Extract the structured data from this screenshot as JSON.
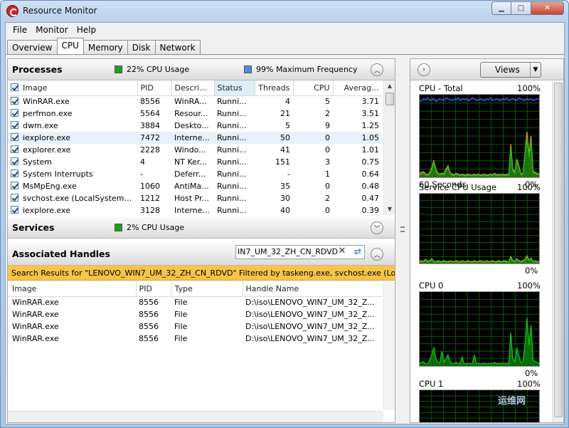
{
  "window": {
    "title": "Resource Monitor"
  },
  "menu": [
    "File",
    "Monitor",
    "Help"
  ],
  "tabs": [
    "Overview",
    "CPU",
    "Memory",
    "Disk",
    "Network"
  ],
  "active_tab": "CPU",
  "processes": {
    "title": "Processes",
    "cpu_usage": "22% CPU Usage",
    "max_frequency": "99% Maximum Frequency",
    "columns": [
      "Image",
      "PID",
      "Descrip...",
      "Status",
      "Threads",
      "CPU",
      "Averag..."
    ],
    "rows": [
      [
        "WinRAR.exe",
        "8556",
        "WinRA...",
        "Runni...",
        "4",
        "5",
        "3.71"
      ],
      [
        "perfmon.exe",
        "5564",
        "Resour...",
        "Runni...",
        "21",
        "2",
        "3.51"
      ],
      [
        "dwm.exe",
        "3884",
        "Deskto...",
        "Runni...",
        "5",
        "9",
        "1.25"
      ],
      [
        "iexplore.exe",
        "7472",
        "Interne...",
        "Runni...",
        "50",
        "0",
        "1.05"
      ],
      [
        "explorer.exe",
        "2228",
        "Windo...",
        "Runni...",
        "41",
        "0",
        "1.01"
      ],
      [
        "System",
        "4",
        "NT Ker...",
        "Runni...",
        "151",
        "3",
        "0.75"
      ],
      [
        "System Interrupts",
        "-",
        "Deferr...",
        "Runni...",
        "-",
        "1",
        "0.64"
      ],
      [
        "MsMpEng.exe",
        "1060",
        "AntiMa...",
        "Runni...",
        "35",
        "0",
        "0.48"
      ],
      [
        "svchost.exe (LocalSystemNet...",
        "1212",
        "Host Pr...",
        "Runni...",
        "30",
        "2",
        "0.47"
      ],
      [
        "iexplore.exe",
        "3128",
        "Interne...",
        "Runni...",
        "40",
        "0",
        "0.39"
      ]
    ]
  },
  "services": {
    "title": "Services",
    "cpu_usage": "2% CPU Usage"
  },
  "handles": {
    "title": "Associated Handles",
    "search_value": "IN7_UM_32_ZH_CN_RDVD",
    "banner": "Search Results for \"LENOVO_WIN7_UM_32_ZH_CN_RDVD\" Filtered by taskeng.exe, svchost.exe (Loc...",
    "columns": [
      "Image",
      "PID",
      "Type",
      "Handle Name"
    ],
    "rows": [
      [
        "WinRAR.exe",
        "8556",
        "File",
        "D:\\iso\\LENOVO_WIN7_UM_32_Z..."
      ],
      [
        "WinRAR.exe",
        "8556",
        "File",
        "D:\\iso\\LENOVO_WIN7_UM_32_Z..."
      ],
      [
        "WinRAR.exe",
        "8556",
        "File",
        "D:\\iso\\LENOVO_WIN7_UM_32_Z..."
      ],
      [
        "WinRAR.exe",
        "8556",
        "File",
        "D:\\iso\\LENOVO_WIN7_UM_32_Z..."
      ]
    ]
  },
  "graphs_panel": {
    "views_label": "Views",
    "graphs": [
      {
        "title": "CPU - Total",
        "top": "100%",
        "bottom_left": "60 Seconds",
        "bottom_right": "0%",
        "series": [
          {
            "color": "#18c018",
            "values": [
              3,
              4,
              5,
              3,
              2,
              4,
              10,
              18,
              8,
              4,
              3,
              4,
              3,
              8,
              12,
              5,
              3,
              2,
              4,
              3,
              2,
              3,
              2,
              2,
              3,
              2,
              2,
              3,
              2,
              3,
              2,
              2,
              3,
              2,
              2,
              3,
              2,
              4,
              2,
              3,
              2,
              3,
              2,
              3,
              2,
              35,
              8,
              5,
              20,
              12,
              3,
              4,
              28,
              48,
              25,
              45,
              6,
              5,
              4,
              3
            ]
          },
          {
            "color": "#e89020",
            "values": [
              5,
              6,
              7,
              4,
              3,
              6,
              12,
              20,
              10,
              5,
              4,
              5,
              4,
              10,
              14,
              6,
              4,
              3,
              5,
              4,
              3,
              4,
              3,
              3,
              4,
              3,
              3,
              4,
              3,
              4,
              3,
              3,
              4,
              3,
              3,
              4,
              3,
              5,
              3,
              4,
              3,
              4,
              3,
              4,
              3,
              40,
              10,
              6,
              22,
              14,
              4,
              5,
              30,
              55,
              28,
              50,
              8,
              6,
              5,
              4
            ]
          },
          {
            "color": "#4060ff",
            "values": [
              92,
              93,
              95,
              94,
              96,
              93,
              94,
              95,
              92,
              94,
              95,
              94,
              93,
              96,
              95,
              94,
              93,
              95,
              94,
              96,
              93,
              95,
              94,
              95,
              93,
              94,
              96,
              95,
              93,
              94,
              95,
              94,
              93,
              95,
              94,
              96,
              93,
              94,
              95,
              94,
              93,
              95,
              94,
              96,
              93,
              94,
              95,
              94,
              93,
              96,
              95,
              94,
              93,
              95,
              94,
              95,
              93,
              94,
              95,
              94
            ]
          }
        ]
      },
      {
        "title": "Service CPU Usage",
        "top": "100%",
        "bottom_left": "",
        "bottom_right": "0%",
        "series": [
          {
            "color": "#18c018",
            "values": [
              2,
              3,
              2,
              5,
              2,
              3,
              6,
              2,
              2,
              3,
              2,
              2,
              3,
              2,
              2,
              3,
              2,
              2,
              3,
              2,
              2,
              3,
              2,
              2,
              3,
              2,
              2,
              3,
              2,
              2,
              3,
              2,
              2,
              3,
              2,
              2,
              3,
              2,
              2,
              3,
              2,
              2,
              3,
              2,
              2,
              8,
              3,
              2,
              6,
              3,
              2,
              3,
              5,
              9,
              4,
              7,
              2,
              3,
              2,
              2
            ]
          },
          {
            "color": "#e89020",
            "values": [
              3,
              4,
              3,
              6,
              3,
              4,
              7,
              3,
              3,
              4,
              3,
              3,
              4,
              3,
              3,
              4,
              3,
              3,
              4,
              3,
              3,
              4,
              3,
              3,
              4,
              3,
              3,
              4,
              3,
              3,
              4,
              3,
              3,
              4,
              3,
              3,
              4,
              3,
              3,
              4,
              3,
              3,
              4,
              3,
              3,
              10,
              4,
              3,
              7,
              4,
              3,
              4,
              6,
              11,
              5,
              8,
              3,
              4,
              3,
              3
            ]
          }
        ]
      },
      {
        "title": "CPU 0",
        "top": "100%",
        "bottom_left": "",
        "bottom_right": "0%",
        "series": [
          {
            "color": "#18c018",
            "values": [
              4,
              5,
              6,
              3,
              3,
              8,
              15,
              25,
              10,
              5,
              4,
              20,
              5,
              10,
              15,
              6,
              4,
              3,
              5,
              4,
              3,
              12,
              3,
              3,
              4,
              3,
              3,
              15,
              3,
              4,
              3,
              3,
              4,
              3,
              3,
              4,
              3,
              5,
              3,
              4,
              3,
              4,
              3,
              4,
              3,
              45,
              10,
              6,
              25,
              14,
              4,
              5,
              30,
              65,
              28,
              55,
              8,
              6,
              5,
              4
            ]
          }
        ]
      },
      {
        "title": "CPU 1",
        "top": "100%",
        "bottom_left": "",
        "bottom_right": "",
        "series": []
      }
    ]
  }
}
